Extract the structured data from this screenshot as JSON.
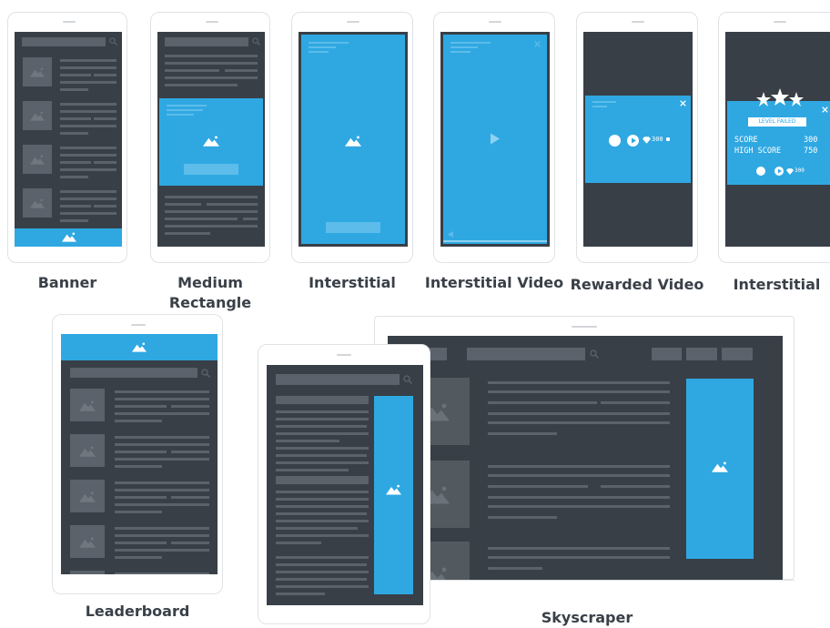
{
  "labels": {
    "banner": "Banner",
    "medium_rectangle_line1": "Medium",
    "medium_rectangle_line2": "Rectangle",
    "interstitial": "Interstitial",
    "interstitial_video": "Interstitial Video",
    "rewarded_video": "Rewarded Video",
    "interstitial_game": "Interstitial",
    "leaderboard": "Leaderboard",
    "skyscraper": "Skyscraper"
  },
  "rewarded": {
    "reward": "300"
  },
  "game": {
    "badge": "LEVEL FAILED",
    "score_label": "SCORE",
    "score_value": "300",
    "highscore_label": "HIGH SCORE",
    "highscore_value": "750",
    "reward": "300"
  },
  "colors": {
    "accent": "#2fa8e2",
    "screen": "#383f47",
    "placeholder": "#5b626b"
  },
  "icons": [
    "search-icon",
    "image-icon",
    "play-icon",
    "close-icon",
    "gem-icon",
    "coin-icon",
    "speaker-icon",
    "stars-icon"
  ]
}
